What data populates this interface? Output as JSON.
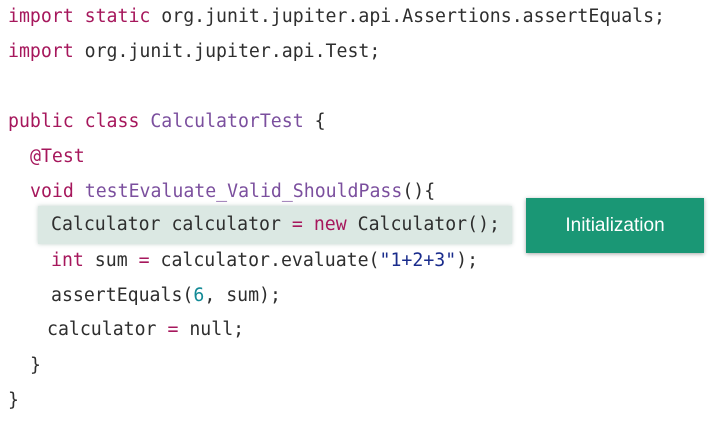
{
  "code": {
    "line1": {
      "kw1": "import",
      "kw2": "static",
      "rest": " org.junit.jupiter.api.Assertions.assertEquals;"
    },
    "line2": {
      "kw1": "import",
      "rest": " org.junit.jupiter.api.Test;"
    },
    "line3": {
      "kw1": "public",
      "kw2": "class",
      "class_name": "CalculatorTest",
      "brace": " {"
    },
    "line4": {
      "annotation": "@Test"
    },
    "line5": {
      "kw1": "void",
      "method": "testEvaluate_Valid_ShouldPass",
      "rest": "(){"
    },
    "line6": {
      "part1": "Calculator calculator ",
      "op": "=",
      "space": " ",
      "kw": "new",
      "part2": " Calculator();"
    },
    "line7": {
      "kw": "int",
      "part1": " sum ",
      "op": "=",
      "part2": " calculator.evaluate(",
      "str": "\"1+2+3\"",
      "part3": ");"
    },
    "line8": {
      "part1": "assertEquals(",
      "num": "6",
      "part2": ", sum);"
    },
    "line9": {
      "part1": "calculator ",
      "op": "=",
      "part2": " null;"
    },
    "line10": {
      "brace": "}"
    },
    "line11": {
      "brace": "}"
    }
  },
  "callout": {
    "label": "Initialization",
    "color": "#1a9775",
    "highlight_color": "#dbe8e3"
  }
}
